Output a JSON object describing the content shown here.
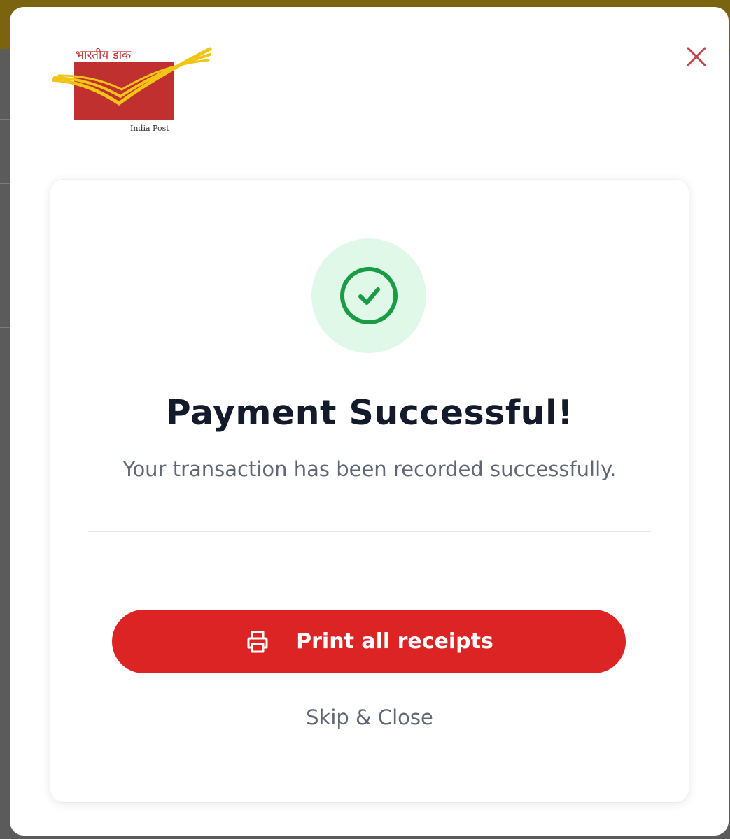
{
  "brand": {
    "logo_text_hindi": "भारतीय डाक",
    "logo_text_english": "India Post",
    "logo_red": "#c0302e",
    "logo_yellow": "#f2c515"
  },
  "modal": {
    "close_icon": "close-icon",
    "status_icon": "check-circle-icon",
    "title": "Payment Successful!",
    "subtitle": "Your transaction has been recorded successfully.",
    "primary_button": {
      "icon": "printer-icon",
      "label": "Print all receipts"
    },
    "secondary_link": "Skip & Close"
  },
  "colors": {
    "accent_red": "#dd2424",
    "success_green": "#1a9b46",
    "success_bg": "#dff8e7",
    "title_text": "#131a2b",
    "muted_text": "#5f6776"
  }
}
